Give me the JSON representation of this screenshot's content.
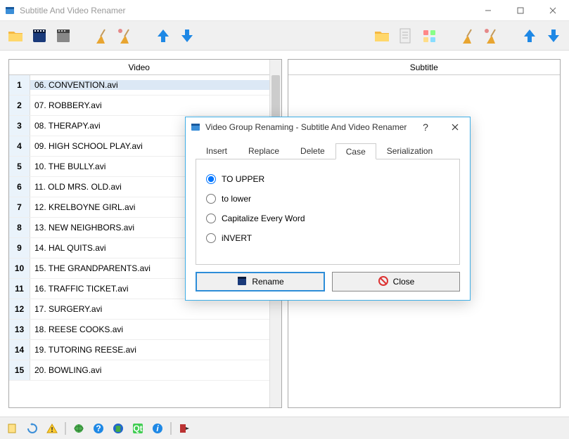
{
  "window_title": "Subtitle And Video Renamer",
  "panels": {
    "video_header": "Video",
    "subtitle_header": "Subtitle"
  },
  "video_rows": [
    {
      "num": "1",
      "name": "06. CONVENTION.avi"
    },
    {
      "num": "2",
      "name": "07. ROBBERY.avi"
    },
    {
      "num": "3",
      "name": "08. THERAPY.avi"
    },
    {
      "num": "4",
      "name": "09. HIGH SCHOOL PLAY.avi"
    },
    {
      "num": "5",
      "name": "10. THE BULLY.avi"
    },
    {
      "num": "6",
      "name": "11. OLD MRS. OLD.avi"
    },
    {
      "num": "7",
      "name": "12. KRELBOYNE GIRL.avi"
    },
    {
      "num": "8",
      "name": "13. NEW NEIGHBORS.avi"
    },
    {
      "num": "9",
      "name": "14. HAL QUITS.avi"
    },
    {
      "num": "10",
      "name": "15. THE GRANDPARENTS.avi"
    },
    {
      "num": "11",
      "name": "16. TRAFFIC TICKET.avi"
    },
    {
      "num": "12",
      "name": "17. SURGERY.avi"
    },
    {
      "num": "13",
      "name": "18. REESE COOKS.avi"
    },
    {
      "num": "14",
      "name": "19. TUTORING REESE.avi"
    },
    {
      "num": "15",
      "name": "20. BOWLING.avi"
    }
  ],
  "dialog": {
    "title": "Video Group Renaming - Subtitle And Video Renamer",
    "tabs": [
      "Insert",
      "Replace",
      "Delete",
      "Case",
      "Serialization"
    ],
    "active_tab": "Case",
    "case_options": [
      "TO UPPER",
      "to lower",
      "Capitalize Every Word",
      "iNVERT"
    ],
    "selected_option": "TO UPPER",
    "rename_btn": "Rename",
    "close_btn": "Close"
  }
}
